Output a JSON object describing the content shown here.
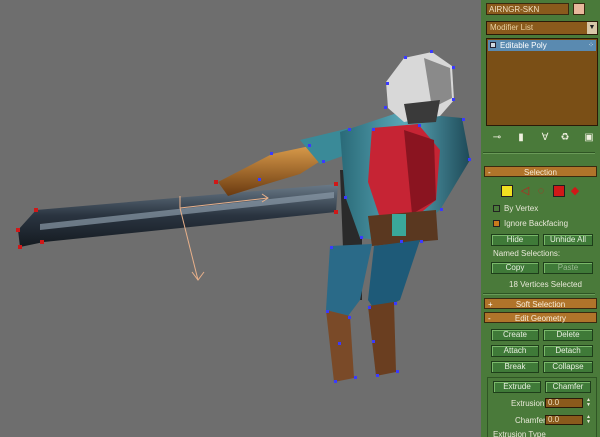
{
  "object_name": "AIRNGR-SKN",
  "modifier_list": {
    "placeholder": "Modifier List"
  },
  "stack": {
    "items": [
      "Editable Poly"
    ]
  },
  "selection": {
    "header": "Selection",
    "by_vertex": "By Vertex",
    "ignore_backfacing": "Ignore Backfacing",
    "hide": "Hide",
    "unhide_all": "Unhide All",
    "named_selections": "Named Selections:",
    "copy": "Copy",
    "paste": "Paste",
    "status": "18 Vertices Selected"
  },
  "soft_selection": {
    "header": "Soft Selection"
  },
  "edit_geometry": {
    "header": "Edit Geometry",
    "create": "Create",
    "delete": "Delete",
    "attach": "Attach",
    "detach": "Detach",
    "break": "Break",
    "collapse": "Collapse",
    "extrude": "Extrude",
    "chamfer": "Chamfer",
    "extrusion_label": "Extrusion:",
    "extrusion_value": "0.0",
    "chamfer_label": "Chamfer",
    "chamfer_value": "0.0",
    "extrusion_type": "Extrusion Type"
  },
  "icons": {
    "pin_stack": "pin-icon",
    "show_end_result": "show-end-result-icon",
    "make_unique": "make-unique-icon",
    "remove_modifier": "remove-modifier-icon",
    "configure_sets": "configure-icon",
    "vertex": "vertex-icon",
    "edge": "edge-icon",
    "border": "border-icon",
    "polygon": "polygon-icon",
    "element": "element-icon"
  },
  "colors": {
    "panel_bg": "#4a7a3a",
    "rollout_header": "#b0742a",
    "field_bg": "#8a5a1c",
    "stack_highlight": "#5a8ab0",
    "viewport_bg": "#6e6e6e"
  }
}
